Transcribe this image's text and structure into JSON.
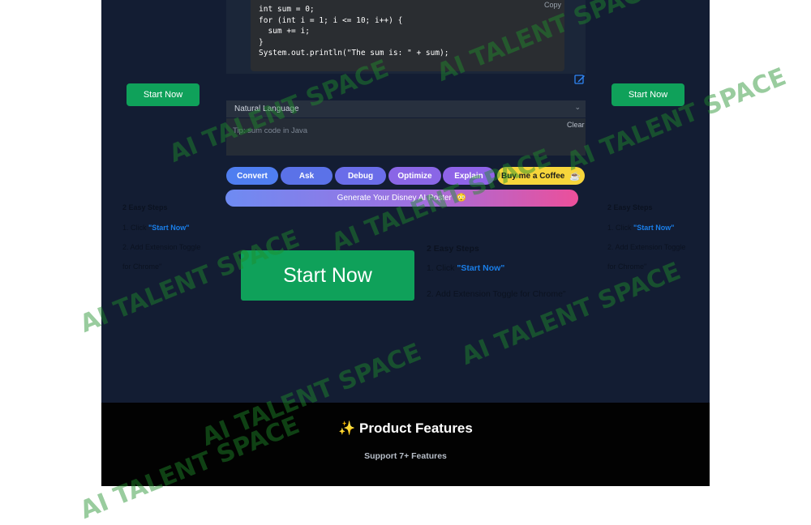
{
  "code": {
    "lines": [
      "int sum = 0;",
      "for (int i = 1; i <= 10; i++) {",
      "  sum += i;",
      "}",
      "System.out.println(\"The sum is: \" + sum);"
    ],
    "copy_label": "Copy"
  },
  "side_start_left": "Start Now",
  "side_start_right": "Start Now",
  "language_select": {
    "value": "Natural Language"
  },
  "input": {
    "placeholder": "Tip: sum code in Java",
    "clear_label": "Clear"
  },
  "actions": {
    "convert": "Convert",
    "ask": "Ask",
    "debug": "Debug",
    "optimize": "Optimize",
    "explain": "Explain",
    "coffee": "Buy me a Coffee"
  },
  "poster": {
    "label": "Generate Your Disney AI Poster",
    "emoji": "😳"
  },
  "steps_left": {
    "title": "2 Easy Steps",
    "step1_prefix": "1. Click ",
    "step1_link": "\"Start Now\"",
    "step2": "2. Add Extension Toggle",
    "step2b": "for Chrome\""
  },
  "steps_right": {
    "title": "2 Easy Steps",
    "step1_prefix": "1. Click ",
    "step1_link": "\"Start Now\"",
    "step2": "2. Add Extension Toggle",
    "step2b": "for Chrome\""
  },
  "steps_main": {
    "title": "2 Easy Steps",
    "step1_prefix": "1. Click ",
    "step1_link": "\"Start Now\"",
    "step2": "2. Add Extension Toggle for Chrome\""
  },
  "big_start": "Start Now",
  "footer": {
    "title": "✨ Product Features",
    "subtitle": "Support 7+ Features"
  },
  "watermark": "AI TALENT SPACE",
  "colors": {
    "panel_bg": "#131d33",
    "start_green": "#0fa15a",
    "link_blue": "#1a7ee8",
    "convert": "#4f7ef0",
    "ask": "#5b72e8",
    "debug": "#6a6de9",
    "optimize": "#8a66e6",
    "explain": "#8f63e8",
    "coffee": "#f7d53b"
  }
}
